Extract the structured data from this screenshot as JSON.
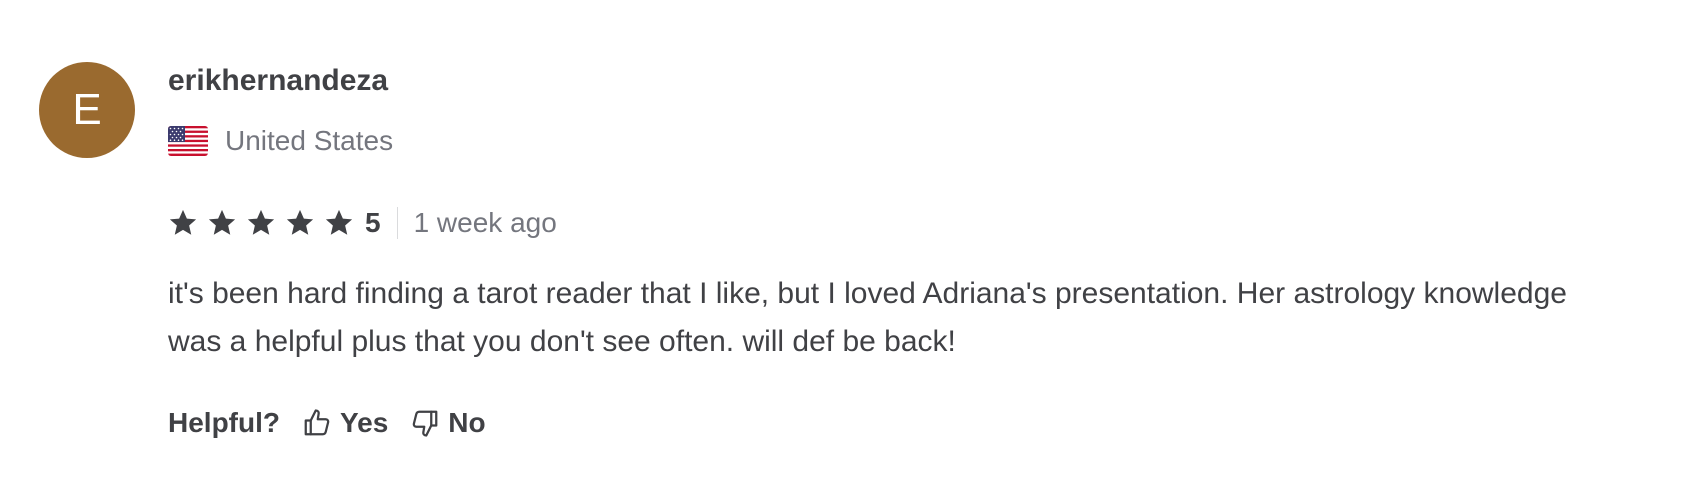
{
  "reviewer": {
    "initial": "E",
    "avatar_color": "#9a6a2f",
    "username": "erikhernandeza",
    "country": "United States",
    "flag_icon": "us-flag-icon"
  },
  "rating": {
    "stars": 5,
    "score": "5",
    "time_ago": "1 week ago"
  },
  "review_text": "it's been hard finding a tarot reader that I like, but I loved Adriana's presentation. Her astrology knowledge was a helpful plus that you don't see often. will def be back!",
  "helpful": {
    "label": "Helpful?",
    "yes_label": "Yes",
    "no_label": "No",
    "yes_icon": "thumbs-up-icon",
    "no_icon": "thumbs-down-icon"
  }
}
